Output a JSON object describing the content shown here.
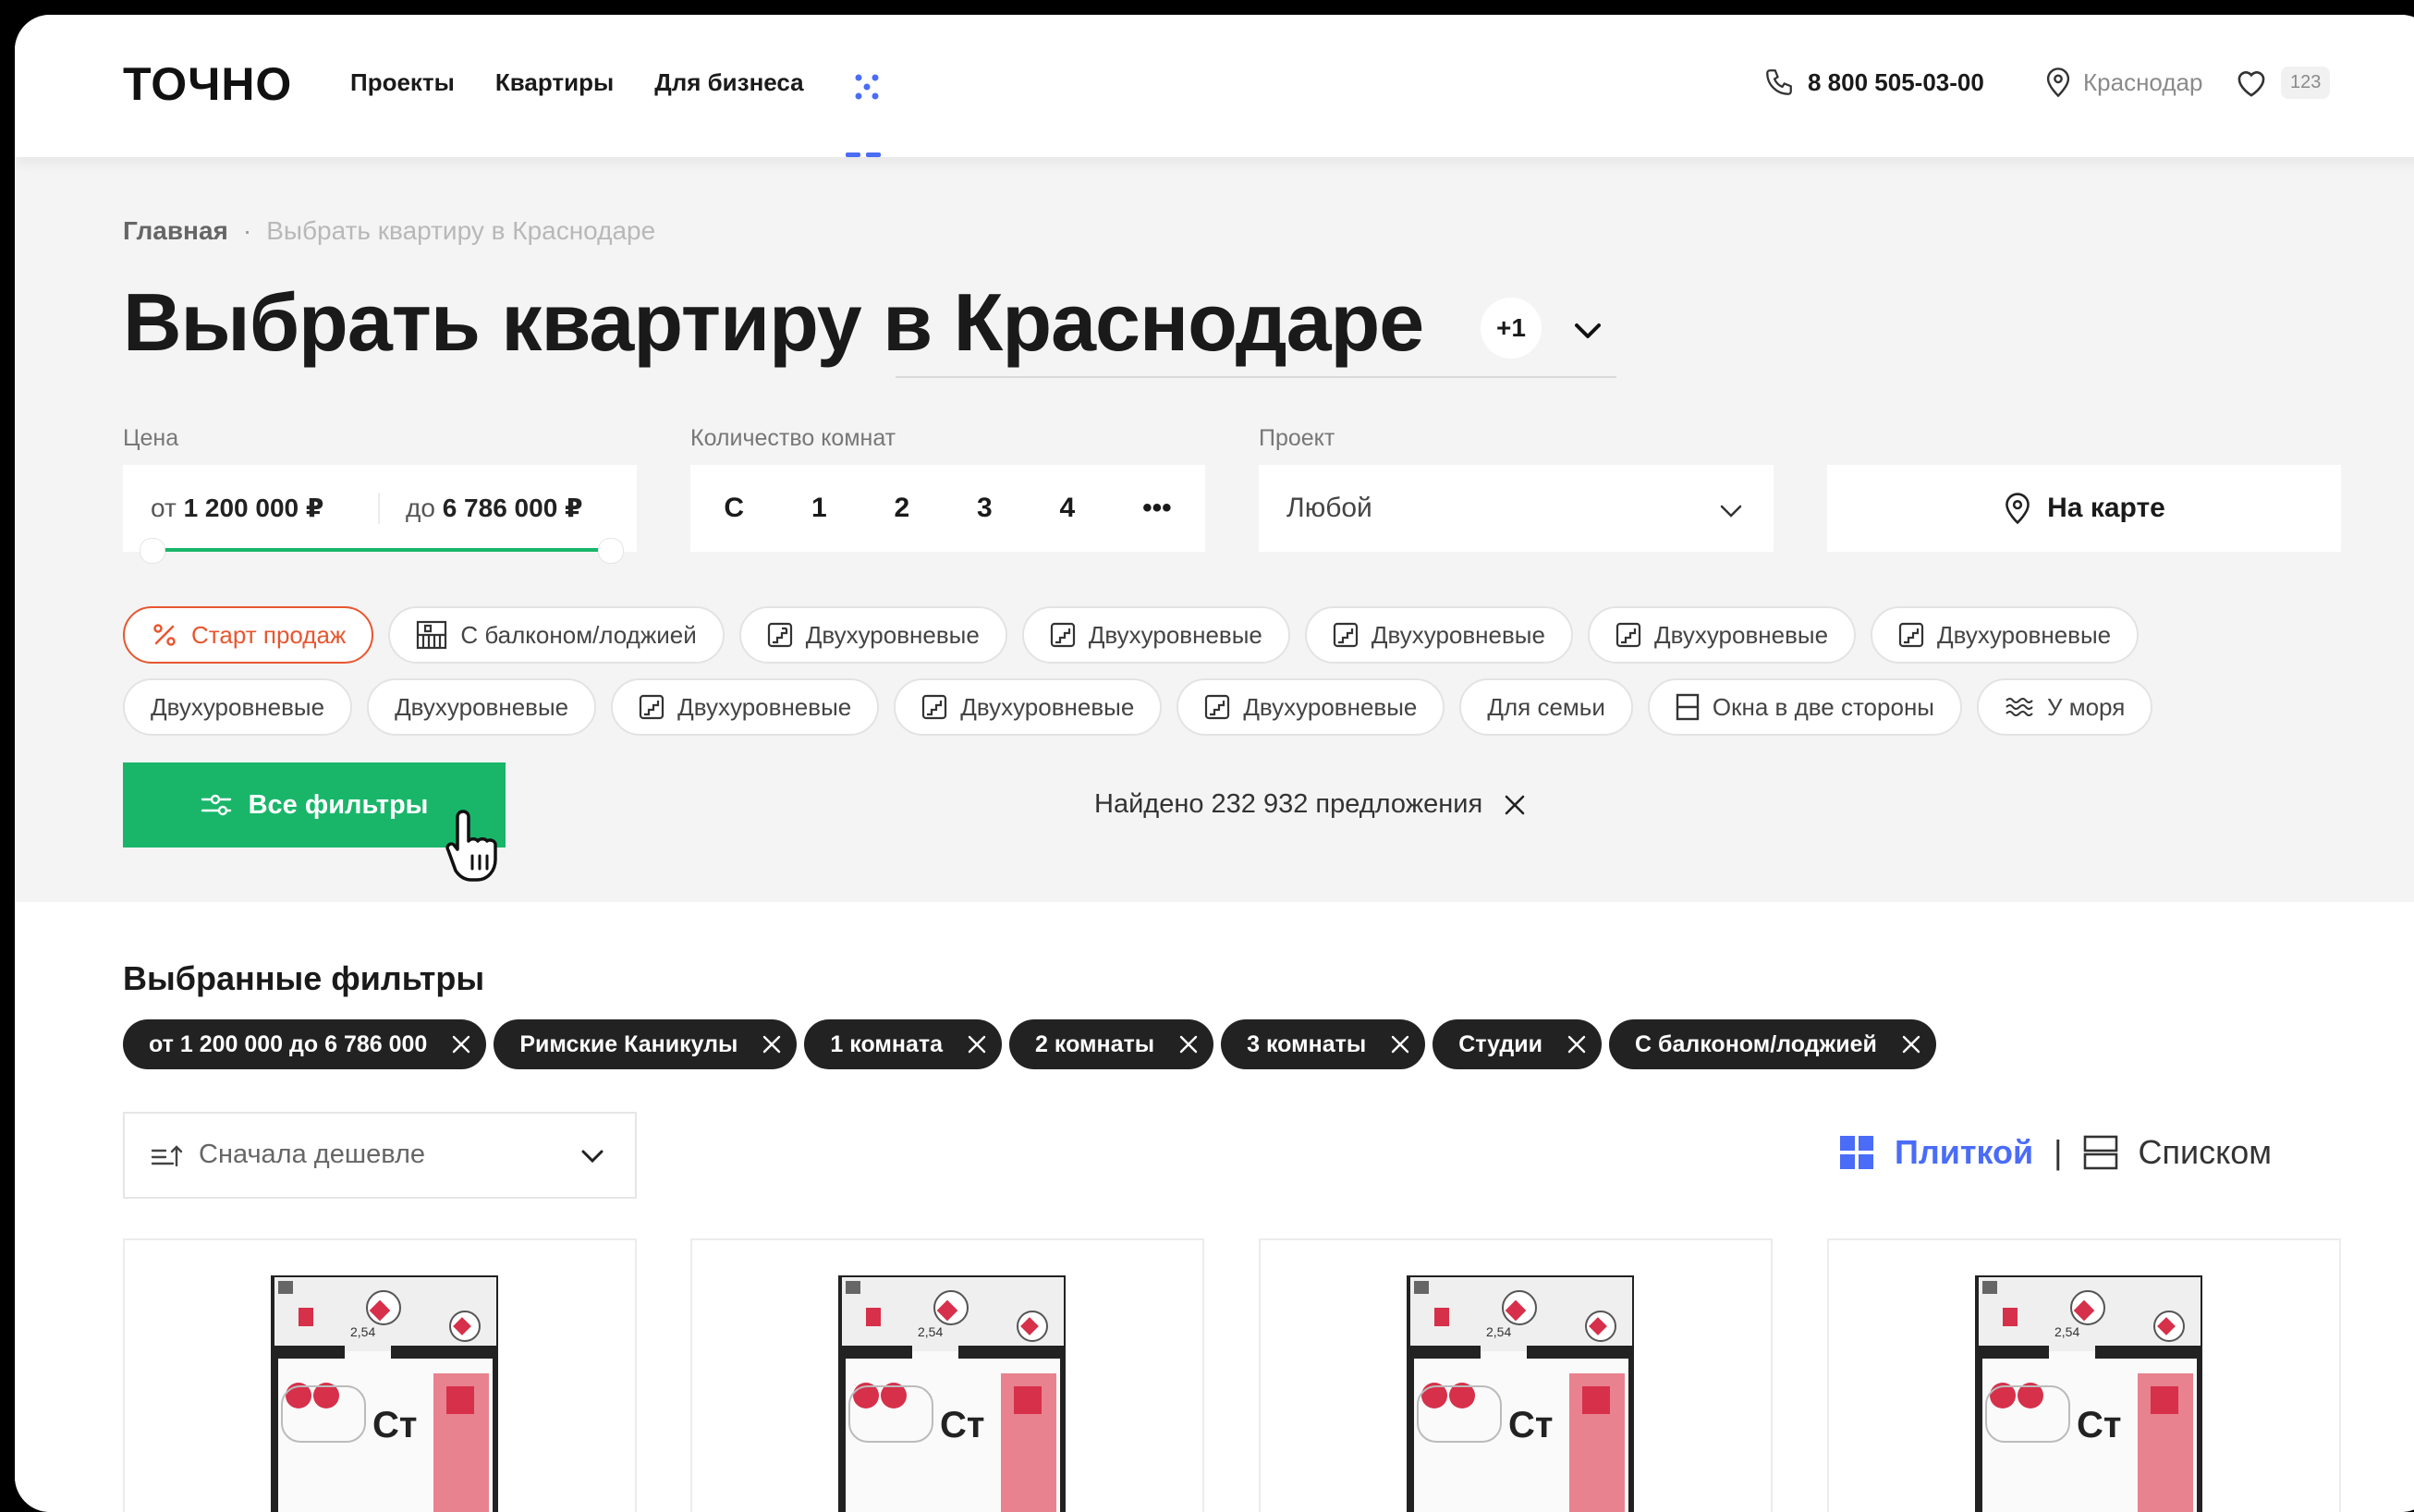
{
  "header": {
    "logo": "ТОЧНО",
    "nav": [
      "Проекты",
      "Квартиры",
      "Для бизнеса"
    ],
    "phone": "8 800 505-03-00",
    "city": "Краснодар",
    "favorites_count": "123"
  },
  "breadcrumbs": {
    "home": "Главная",
    "current": "Выбрать квартиру в Краснодаре"
  },
  "title": "Выбрать квартиру в Краснодаре",
  "title_badge": "+1",
  "filters": {
    "price_label": "Цена",
    "price_from_prefix": "от",
    "price_from": "1 200 000 ₽",
    "price_to_prefix": "до",
    "price_to": "6 786 000 ₽",
    "rooms_label": "Количество комнат",
    "rooms": [
      "С",
      "1",
      "2",
      "3",
      "4",
      "•••"
    ],
    "project_label": "Проект",
    "project_value": "Любой",
    "map_button": "На карте"
  },
  "chips_row1": [
    {
      "label": "Старт продаж",
      "icon": "percent-icon"
    },
    {
      "label": "С балконом/лоджией",
      "icon": "balcony-icon"
    },
    {
      "label": "Двухуровневые",
      "icon": "stairs-icon"
    },
    {
      "label": "Двухуровневые",
      "icon": "stairs-icon"
    },
    {
      "label": "Двухуровневые",
      "icon": "stairs-icon"
    },
    {
      "label": "Двухуровневые",
      "icon": "stairs-icon"
    },
    {
      "label": "Двухуровневые",
      "icon": "stairs-icon"
    }
  ],
  "chips_row2": [
    {
      "label": "Двухуровневые",
      "icon": ""
    },
    {
      "label": "Двухуровневые",
      "icon": ""
    },
    {
      "label": "Двухуровневые",
      "icon": "stairs-icon"
    },
    {
      "label": "Двухуровневые",
      "icon": "stairs-icon"
    },
    {
      "label": "Двухуровневые",
      "icon": "stairs-icon"
    },
    {
      "label": "Для семьи",
      "icon": ""
    },
    {
      "label": "Окна в две стороны",
      "icon": "window-icon"
    },
    {
      "label": "У моря",
      "icon": "waves-icon"
    }
  ],
  "all_filters_button": "Все фильтры",
  "found_text": "Найдено 232 932 предложения",
  "selected": {
    "title": "Выбранные фильтры",
    "tags": [
      "от 1 200 000 до 6 786 000",
      "Римские Каникулы",
      "1 комната",
      "2 комнаты",
      "3 комнаты",
      "Студии",
      "С балконом/лоджией"
    ]
  },
  "sort": {
    "value": "Сначала дешевле"
  },
  "view": {
    "tile": "Плиткой",
    "separator": "|",
    "list": "Списком"
  },
  "cards": [
    {
      "room_label": "Ст",
      "dimension": "2,54"
    },
    {
      "room_label": "Ст",
      "dimension": "2,54"
    },
    {
      "room_label": "Ст",
      "dimension": "2,54"
    },
    {
      "room_label": "Ст",
      "dimension": "2,54"
    }
  ],
  "colors": {
    "accent_green": "#19b66a",
    "accent_blue": "#4a6cf7",
    "accent_orange": "#e8562f",
    "plan_red": "#d6304a"
  }
}
